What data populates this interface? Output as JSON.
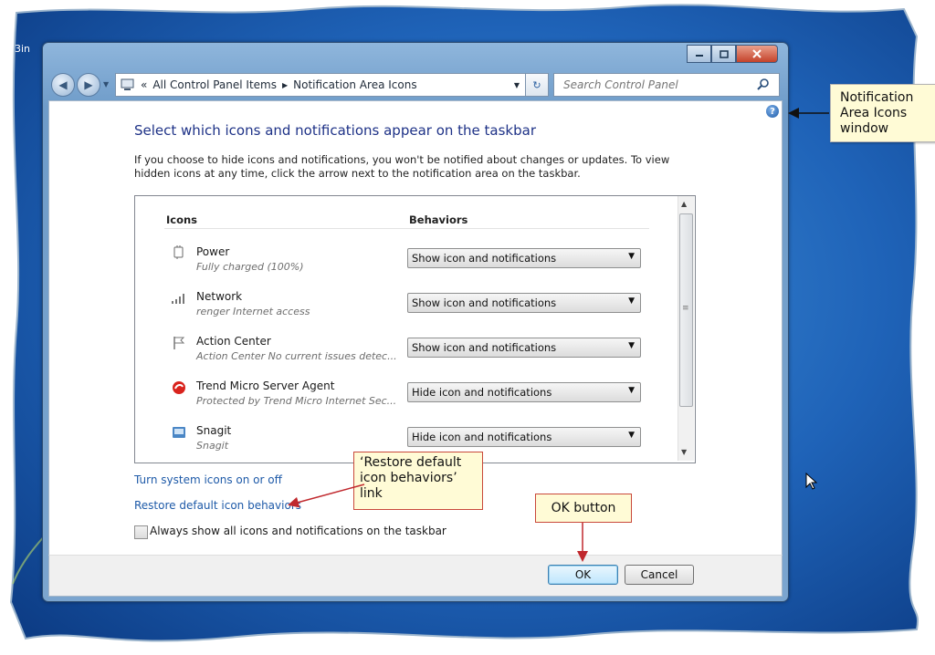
{
  "desktop": {
    "corner_label": "3in"
  },
  "breadcrumb": {
    "root_marker": "«",
    "items": [
      "All Control Panel Items",
      "Notification Area Icons"
    ]
  },
  "search": {
    "placeholder": "Search Control Panel"
  },
  "page": {
    "title": "Select which icons and notifications appear on the taskbar",
    "description": "If you choose to hide icons and notifications, you won't be notified about changes or updates. To view hidden icons at any time, click the arrow next to the notification area on the taskbar."
  },
  "table": {
    "col_icons": "Icons",
    "col_behaviors": "Behaviors",
    "rows": [
      {
        "name": "Power",
        "sub": "Fully charged (100%)",
        "icon": "power-plug-icon",
        "behavior": "Show icon and notifications"
      },
      {
        "name": "Network",
        "sub": "renger Internet access",
        "icon": "network-signal-icon",
        "behavior": "Show icon and notifications"
      },
      {
        "name": "Action Center",
        "sub": "Action Center  No current issues detec...",
        "icon": "flag-icon",
        "behavior": "Show icon and notifications"
      },
      {
        "name": "Trend Micro Server Agent",
        "sub": "Protected by Trend Micro Internet Sec...",
        "icon": "trend-micro-icon",
        "behavior": "Hide icon and notifications"
      },
      {
        "name": "Snagit",
        "sub": "Snagit",
        "icon": "snagit-icon",
        "behavior": "Hide icon and notifications"
      }
    ]
  },
  "links": {
    "turn_system_icons": "Turn system icons on or off",
    "restore_defaults": "Restore default icon behaviors"
  },
  "checkbox": {
    "label": "Always show all icons and notifications on the taskbar",
    "checked": false
  },
  "buttons": {
    "ok": "OK",
    "cancel": "Cancel"
  },
  "callouts": {
    "window": [
      "Notification",
      "Area Icons",
      "window"
    ],
    "restore_link": [
      "‘Restore default",
      "icon behaviors’",
      "link"
    ],
    "ok_button": "OK button"
  },
  "colors": {
    "callout_border": "#c9483a",
    "callout_fill": "#fffbd6",
    "arrow": "#c0282d",
    "link": "#1e5aa8",
    "title": "#1e3287"
  }
}
